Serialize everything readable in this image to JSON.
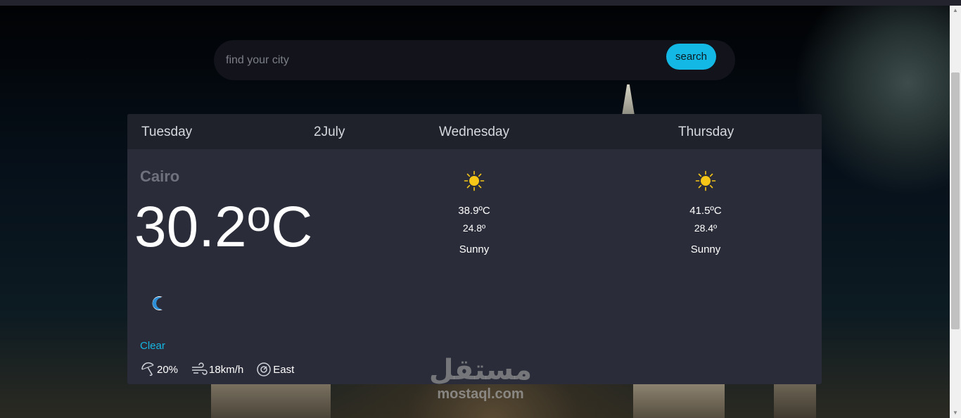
{
  "search": {
    "placeholder": "find your city",
    "button_label": "search"
  },
  "header": {
    "day": "Tuesday",
    "date": "2July",
    "forecast_days": [
      "Wednesday",
      "Thursday"
    ]
  },
  "current": {
    "city": "Cairo",
    "temperature": "30.2",
    "unit": "C",
    "degree_symbol": "o",
    "icon": "moon-icon",
    "condition": "Clear",
    "stats": {
      "rain": "20%",
      "wind": "18km/h",
      "direction": "East"
    }
  },
  "forecast": [
    {
      "day": "Wednesday",
      "icon": "sun-icon",
      "max": "38.9ºC",
      "min": "24.8º",
      "condition": "Sunny"
    },
    {
      "day": "Thursday",
      "icon": "sun-icon",
      "max": "41.5ºC",
      "min": "28.4º",
      "condition": "Sunny"
    }
  ],
  "watermark": {
    "logo": "مستقل",
    "text": "mostaql.com"
  },
  "colors": {
    "accent": "#14b8e4",
    "card": "#2a2d39",
    "card_header": "#1f212b",
    "sun": "#f5c518"
  }
}
